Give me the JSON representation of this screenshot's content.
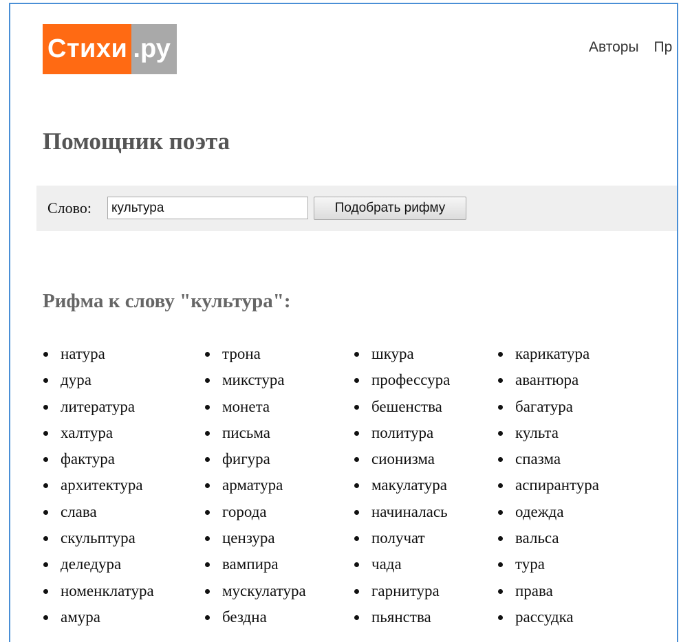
{
  "header": {
    "logo_main": "Стихи",
    "logo_tld": ".ру",
    "nav": [
      "Авторы",
      "Пр"
    ]
  },
  "page_title": "Помощник поэта",
  "search": {
    "label": "Слово:",
    "value": "культура",
    "button_label": "Подобрать рифму"
  },
  "results": {
    "heading": "Рифма к слову \"культура\":",
    "columns": [
      [
        "натура",
        "дура",
        "литература",
        "халтура",
        "фактура",
        "архитектура",
        "слава",
        "скульптура",
        "деледура",
        "номенклатура",
        "амура"
      ],
      [
        "трона",
        "микстура",
        "монета",
        "письма",
        "фигура",
        "арматура",
        "города",
        "цензура",
        "вампира",
        "мускулатура",
        "бездна"
      ],
      [
        "шкура",
        "профессура",
        "бешенства",
        "политура",
        "сионизма",
        "макулатура",
        "начиналась",
        "получат",
        "чада",
        "гарнитура",
        "пьянства"
      ],
      [
        "карикатура",
        "авантюра",
        "багатура",
        "культа",
        "спазма",
        "аспирантура",
        "одежда",
        "вальса",
        "тура",
        "права",
        "рассудка"
      ]
    ]
  }
}
